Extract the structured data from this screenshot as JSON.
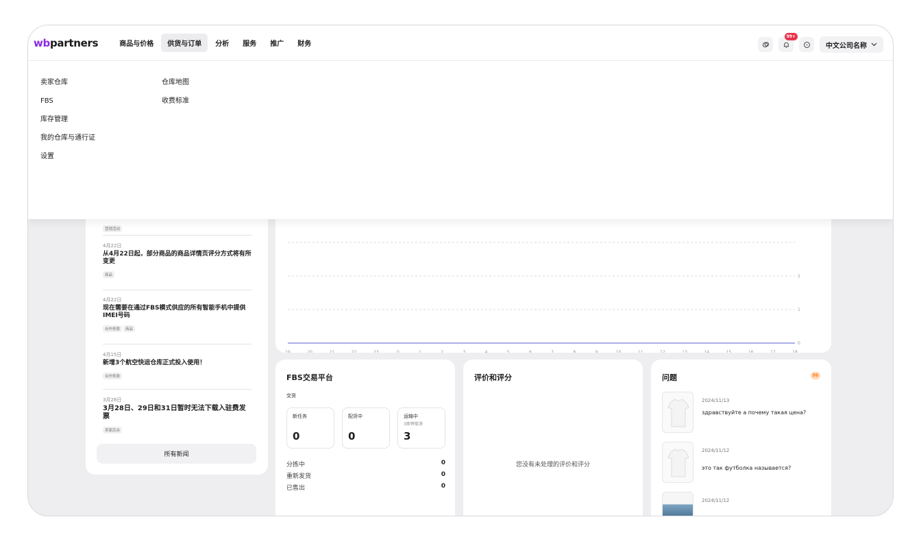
{
  "logo": {
    "prefix": "wb",
    "suffix": "partners"
  },
  "nav": [
    "商品与价格",
    "供货与订单",
    "分析",
    "服务",
    "推广",
    "财务"
  ],
  "nav_active_index": 1,
  "header": {
    "notification_count": "99+",
    "company": "中文公司名称"
  },
  "dropdown": {
    "left": [
      "卖家仓库",
      "FBS",
      "库存管理",
      "我的仓库与通行证",
      "设置"
    ],
    "right": [
      "仓库地图",
      "收费标准"
    ]
  },
  "news": {
    "items": [
      {
        "date": "",
        "title": "",
        "tags": [
          "营销活动"
        ]
      },
      {
        "date": "4月22日",
        "title": "从4月22日起，部分商品的商品详情页评分方式将有所变更",
        "tags": [
          "商品"
        ]
      },
      {
        "date": "4月22日",
        "title": "现在需要在通过FBS模式供应的所有智能手机中提供IMEI号码",
        "tags": [
          "合作条款",
          "商品"
        ]
      },
      {
        "date": "4月15日",
        "title": "新增3个航空快运仓库正式投入使用！",
        "tags": [
          "合作条款"
        ]
      },
      {
        "date": "3月28日",
        "title": "3月28日、29日和31日暂时无法下载入驻费发票",
        "tags": [
          "卖家后台"
        ]
      }
    ],
    "all_label": "所有新闻"
  },
  "chart_data": {
    "type": "line",
    "x": [
      "19",
      "20",
      "21",
      "22",
      "23",
      "0",
      "1",
      "2",
      "3",
      "4",
      "5",
      "6",
      "7",
      "8",
      "9",
      "10",
      "11",
      "12",
      "13",
      "14",
      "15",
      "16",
      "17",
      "18"
    ],
    "series": [
      {
        "values": [
          0,
          0,
          0,
          0,
          0,
          0,
          0,
          0,
          0,
          0,
          0,
          0,
          0,
          0,
          0,
          0,
          0,
          0,
          0,
          0,
          0,
          0,
          0,
          0
        ]
      }
    ],
    "y_ticks": [
      "0",
      "1",
      "2"
    ],
    "ylim": [
      0,
      3
    ],
    "grid": true,
    "colors": {
      "line": "#8f93e0",
      "grid": "#d9d9de"
    }
  },
  "fbs": {
    "title": "FBS交易平台",
    "subtitle": "交货",
    "stats": [
      {
        "label": "新任务",
        "sub": "",
        "value": "0"
      },
      {
        "label": "配货中",
        "sub": "",
        "value": "0"
      },
      {
        "label": "运输中",
        "sub": "3即将取消",
        "value": "3"
      }
    ],
    "rows": [
      {
        "label": "分拣中",
        "value": "0"
      },
      {
        "label": "重新发货",
        "value": "0"
      },
      {
        "label": "已售出",
        "value": "0"
      }
    ]
  },
  "reviews": {
    "title": "评价和评分",
    "empty": "您没有未处理的评价和评分"
  },
  "questions": {
    "title": "问题",
    "count": "99",
    "items": [
      {
        "date": "2024/11/13",
        "text": "здравствуйте а почему такая цена?"
      },
      {
        "date": "2024/11/12",
        "text": "это так футболка называется?"
      },
      {
        "date": "2024/11/12",
        "text": ""
      }
    ]
  }
}
